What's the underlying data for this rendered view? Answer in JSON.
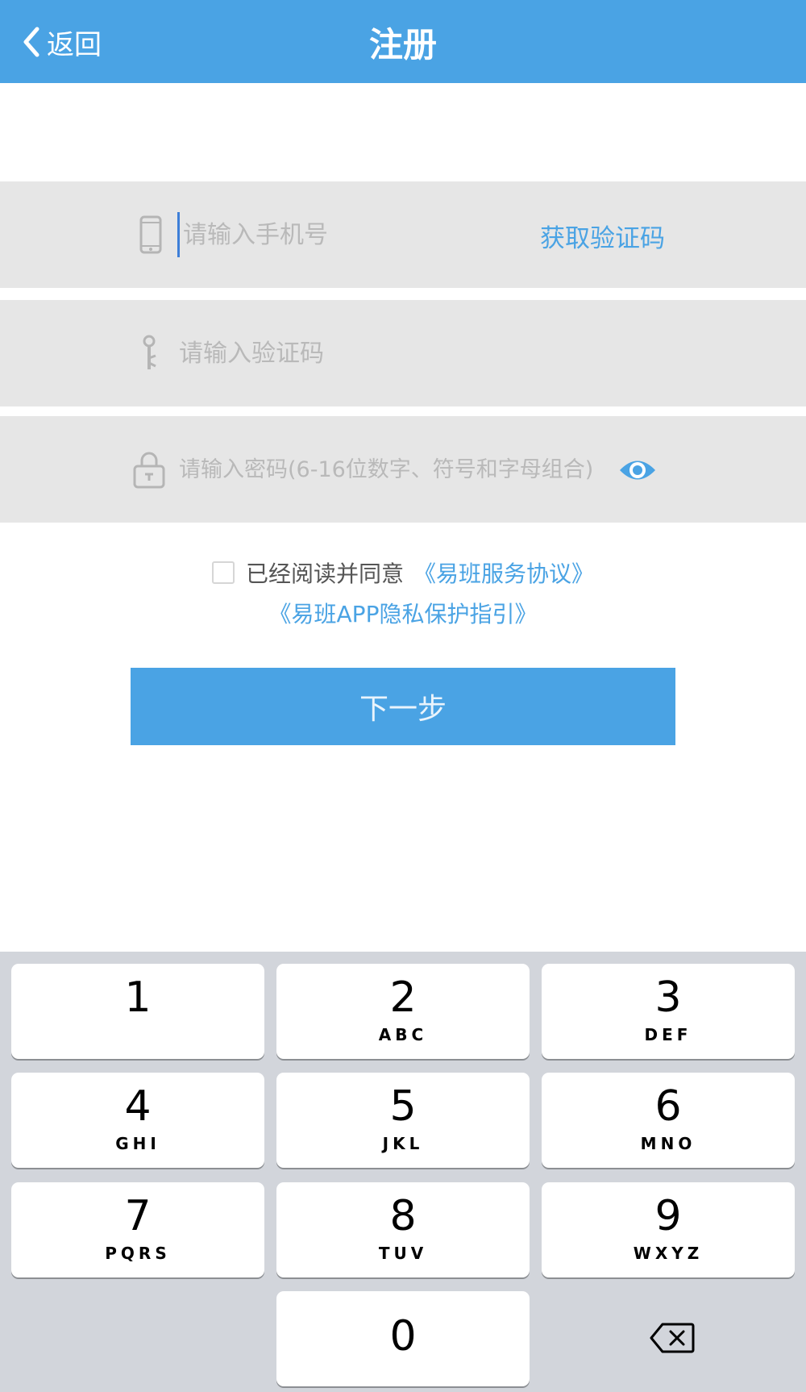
{
  "nav": {
    "back_label": "返回",
    "title": "注册"
  },
  "form": {
    "phone_placeholder": "请输入手机号",
    "get_code_label": "获取验证码",
    "code_placeholder": "请输入验证码",
    "password_placeholder": "请输入密码(6-16位数字、符号和字母组合)"
  },
  "agreement": {
    "prefix": "已经阅读并同意",
    "service_link": "《易班服务协议》",
    "privacy_link": "《易班APP隐私保护指引》"
  },
  "next_button_label": "下一步",
  "keypad": {
    "k1": {
      "num": "1",
      "letters": ""
    },
    "k2": {
      "num": "2",
      "letters": "ABC"
    },
    "k3": {
      "num": "3",
      "letters": "DEF"
    },
    "k4": {
      "num": "4",
      "letters": "GHI"
    },
    "k5": {
      "num": "5",
      "letters": "JKL"
    },
    "k6": {
      "num": "6",
      "letters": "MNO"
    },
    "k7": {
      "num": "7",
      "letters": "PQRS"
    },
    "k8": {
      "num": "8",
      "letters": "TUV"
    },
    "k9": {
      "num": "9",
      "letters": "WXYZ"
    },
    "k0": {
      "num": "0",
      "letters": ""
    }
  },
  "icons": {
    "back": "chevron-left-icon",
    "phone": "phone-icon",
    "key": "key-icon",
    "lock": "lock-icon",
    "eye": "eye-icon",
    "delete": "backspace-icon"
  },
  "colors": {
    "primary": "#4aa3e4",
    "field_bg": "#e6e6e6",
    "keyboard_bg": "#d2d5db"
  }
}
